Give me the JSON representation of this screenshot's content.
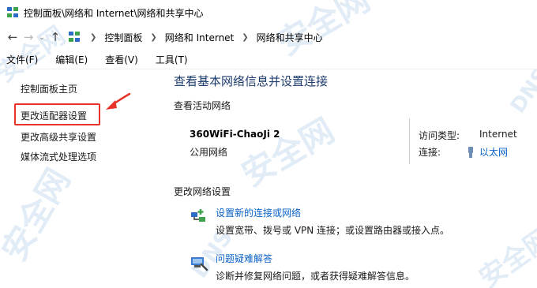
{
  "window": {
    "title": "控制面板\\网络和 Internet\\网络和共享中心"
  },
  "nav": {
    "back_icon": "arrow-left-icon",
    "forward_icon": "arrow-right-icon",
    "up_icon": "arrow-up-icon",
    "breadcrumbs": [
      "控制面板",
      "网络和 Internet",
      "网络和共享中心"
    ]
  },
  "menu": {
    "items": [
      "文件(F)",
      "编辑(E)",
      "查看(V)",
      "工具(T)"
    ]
  },
  "sidebar": {
    "items": [
      {
        "label": "控制面板主页"
      },
      {
        "label": "更改适配器设置"
      },
      {
        "label": "更改高级共享设置"
      },
      {
        "label": "媒体流式处理选项"
      }
    ]
  },
  "main": {
    "title": "查看基本网络信息并设置连接",
    "active_networks_label": "查看活动网络",
    "network": {
      "name": "360WiFi-ChaoJi 2",
      "type": "公用网络",
      "access_type_label": "访问类型:",
      "access_type_value": "Internet",
      "connection_label": "连接:",
      "connection_value": "以太网"
    },
    "change_settings_label": "更改网络设置",
    "tasks": [
      {
        "link": "设置新的连接或网络",
        "desc": "设置宽带、拨号或 VPN 连接；或设置路由器或接入点。"
      },
      {
        "link": "问题疑难解答",
        "desc": "诊断并修复网络问题，或者获得疑难解答信息。"
      }
    ]
  },
  "colors": {
    "link": "#0b63c8",
    "title": "#1e3d6f",
    "highlight": "#e8332a"
  },
  "watermark": {
    "cn": "安全网",
    "en": "DNS"
  }
}
